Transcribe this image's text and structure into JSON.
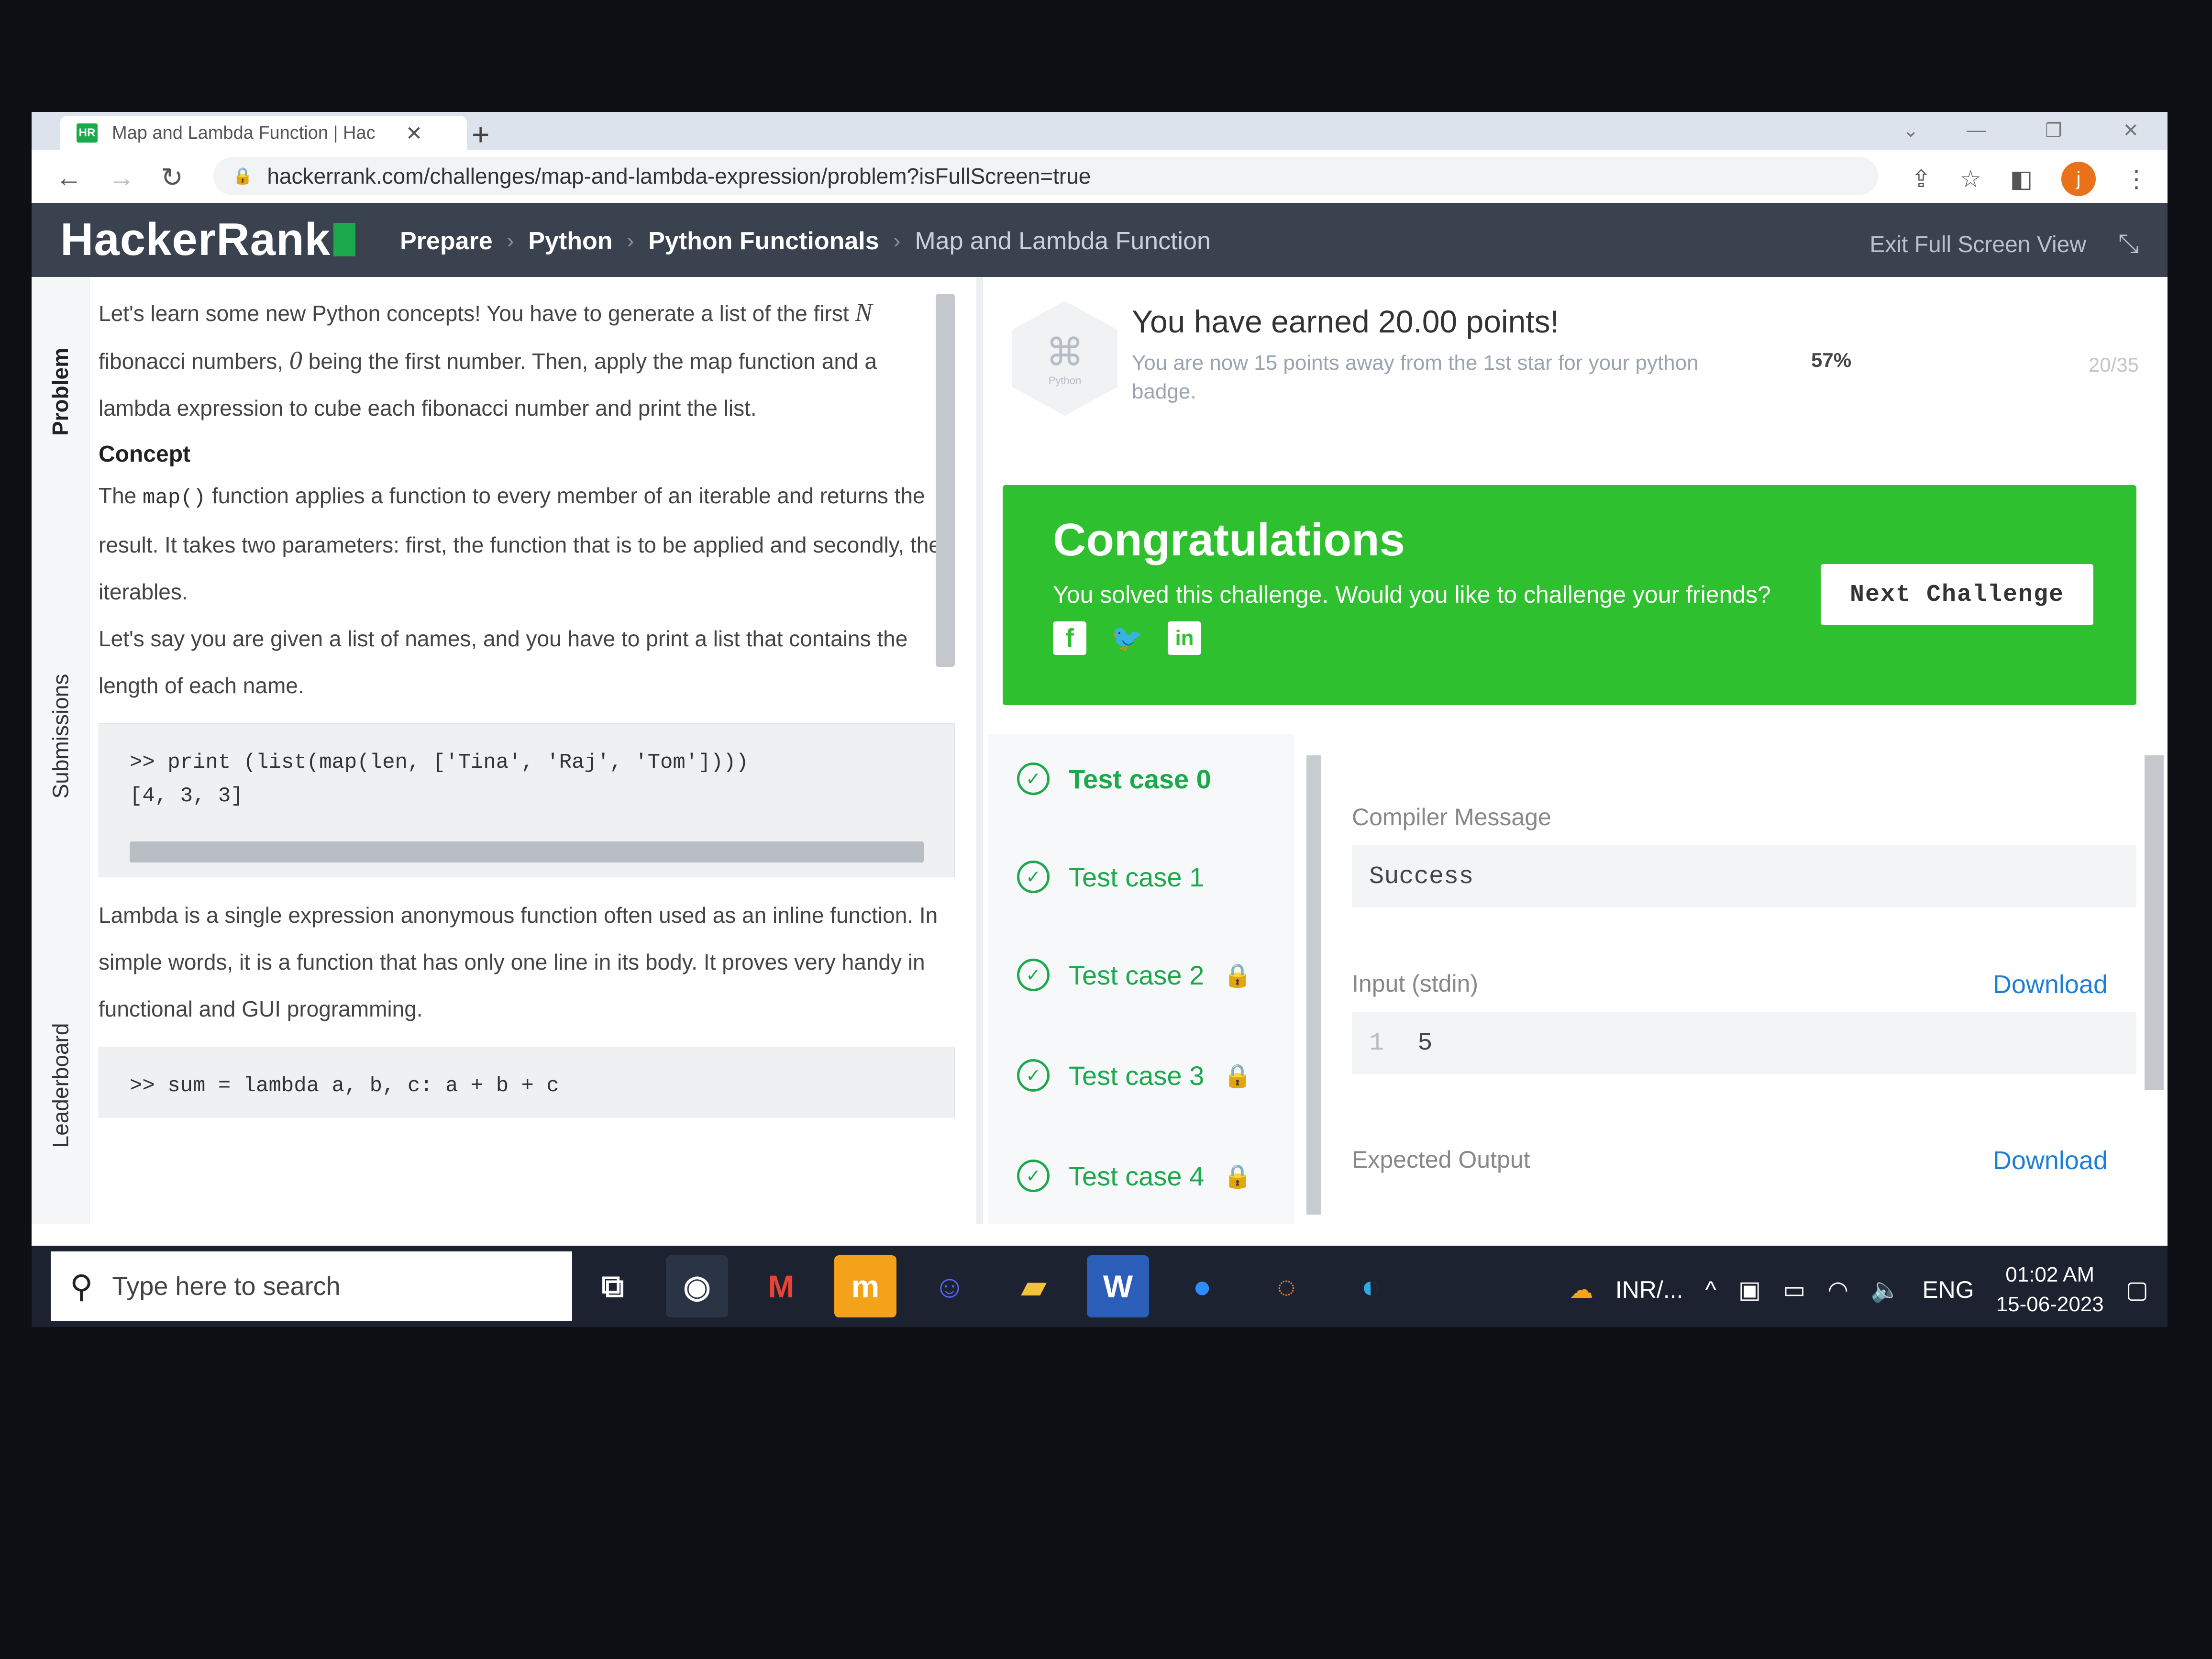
{
  "browser": {
    "tab_title": "Map and Lambda Function | Hac",
    "tab_favicon": "HR",
    "new_tab": "+",
    "url": "hackerrank.com/challenges/map-and-lambda-expression/problem?isFullScreen=true",
    "avatar_letter": "j"
  },
  "header": {
    "logo": "HackerRank",
    "breadcrumbs": [
      "Prepare",
      "Python",
      "Python Functionals",
      "Map and Lambda Function"
    ],
    "exit_fullscreen": "Exit Full Screen View"
  },
  "side_tabs": [
    "Problem",
    "Submissions",
    "Leaderboard"
  ],
  "problem": {
    "intro_1": "Let's learn some new Python concepts! You have to generate a list of the first ",
    "intro_var_n": "N",
    "intro_2": " fibonacci numbers, ",
    "intro_var_zero": "0",
    "intro_3": " being the first number. Then, apply the map function and a lambda expression to cube each fibonacci number and print the list.",
    "concept_heading": "Concept",
    "concept_1a": "The ",
    "concept_1_code": "map()",
    "concept_1b": " function applies a function to every member of an iterable and returns the result. It takes two parameters: first, the function that is to be applied and secondly, the iterables.",
    "concept_2": "Let's say you are given a list of names, and you have to print a list that contains the length of each name.",
    "code_1_line_1": ">> print (list(map(len, ['Tina', 'Raj', 'Tom'])))",
    "code_1_line_2": "[4, 3, 3]",
    "lambda_text": "Lambda is a single expression anonymous function often used as an inline function. In simple words, it is a function that has only one line in its body. It proves very handy in functional and GUI programming.",
    "code_2_line_1": ">> sum = lambda a, b, c: a + b + c"
  },
  "progress": {
    "badge_label": "Python",
    "earned": "You have earned 20.00 points!",
    "away": "You are now 15 points away from the 1st star for your python badge.",
    "percent": "57%",
    "fraction": "20/35"
  },
  "congrats": {
    "title": "Congratulations",
    "subtitle": "You solved this challenge. Would you like to challenge your friends?",
    "next_button": "Next Challenge",
    "bg_color": "#2ec02e"
  },
  "test_cases": [
    "Test case 0",
    "Test case 1",
    "Test case 2",
    "Test case 3",
    "Test case 4"
  ],
  "result": {
    "compiler_label": "Compiler Message",
    "compiler_value": "Success",
    "input_label": "Input (stdin)",
    "input_line_no": "1",
    "input_value": "5",
    "expected_label": "Expected Output",
    "download": "Download"
  },
  "taskbar": {
    "search_placeholder": "Type here to search",
    "weather": "INR/...",
    "language": "ENG",
    "time": "01:02 AM",
    "date": "15-06-2023"
  }
}
